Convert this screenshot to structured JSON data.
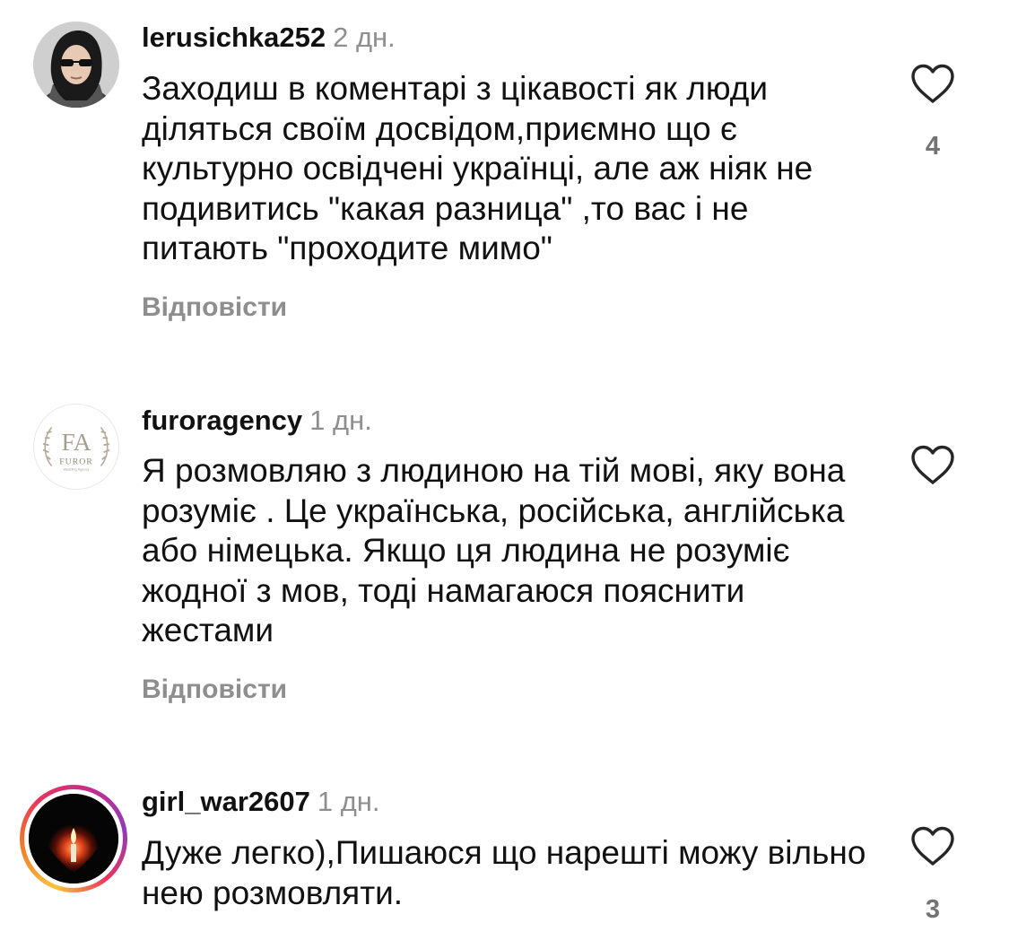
{
  "comments": [
    {
      "username": "lerusichka252",
      "time": "2 дн.",
      "text": "Заходиш в коментарі з цікавості як люди діляться своїм досвідом,приємно що є культурно освідчені українці, але аж ніяк не подивитись \"какая разница\" ,то вас і не питають \"проходите мимо\"",
      "reply_label": "Відповісти",
      "likes": "4"
    },
    {
      "username": "furoragency",
      "time": "1 дн.",
      "text": "Я розмовляю з людиною на тій мові, яку вона розуміє . Це українська, російська, англійська або німецька. Якщо ця людина не розуміє жодної з мов,  тоді намагаюся пояснити жестами",
      "reply_label": "Відповісти",
      "avatar_logo": {
        "monogram": "FA",
        "name": "FUROR",
        "tagline": "Wedding Agency"
      }
    },
    {
      "username": "girl_war2607",
      "time": "1 дн.",
      "text": "Дуже легко),Пишаюся що нарешті можу вільно нею розмовляти.",
      "likes": "3"
    }
  ],
  "icons": {
    "like": "heart-outline-icon"
  },
  "colors": {
    "text": "#111111",
    "secondary": "#8e8e8e",
    "like_count": "#737373"
  }
}
